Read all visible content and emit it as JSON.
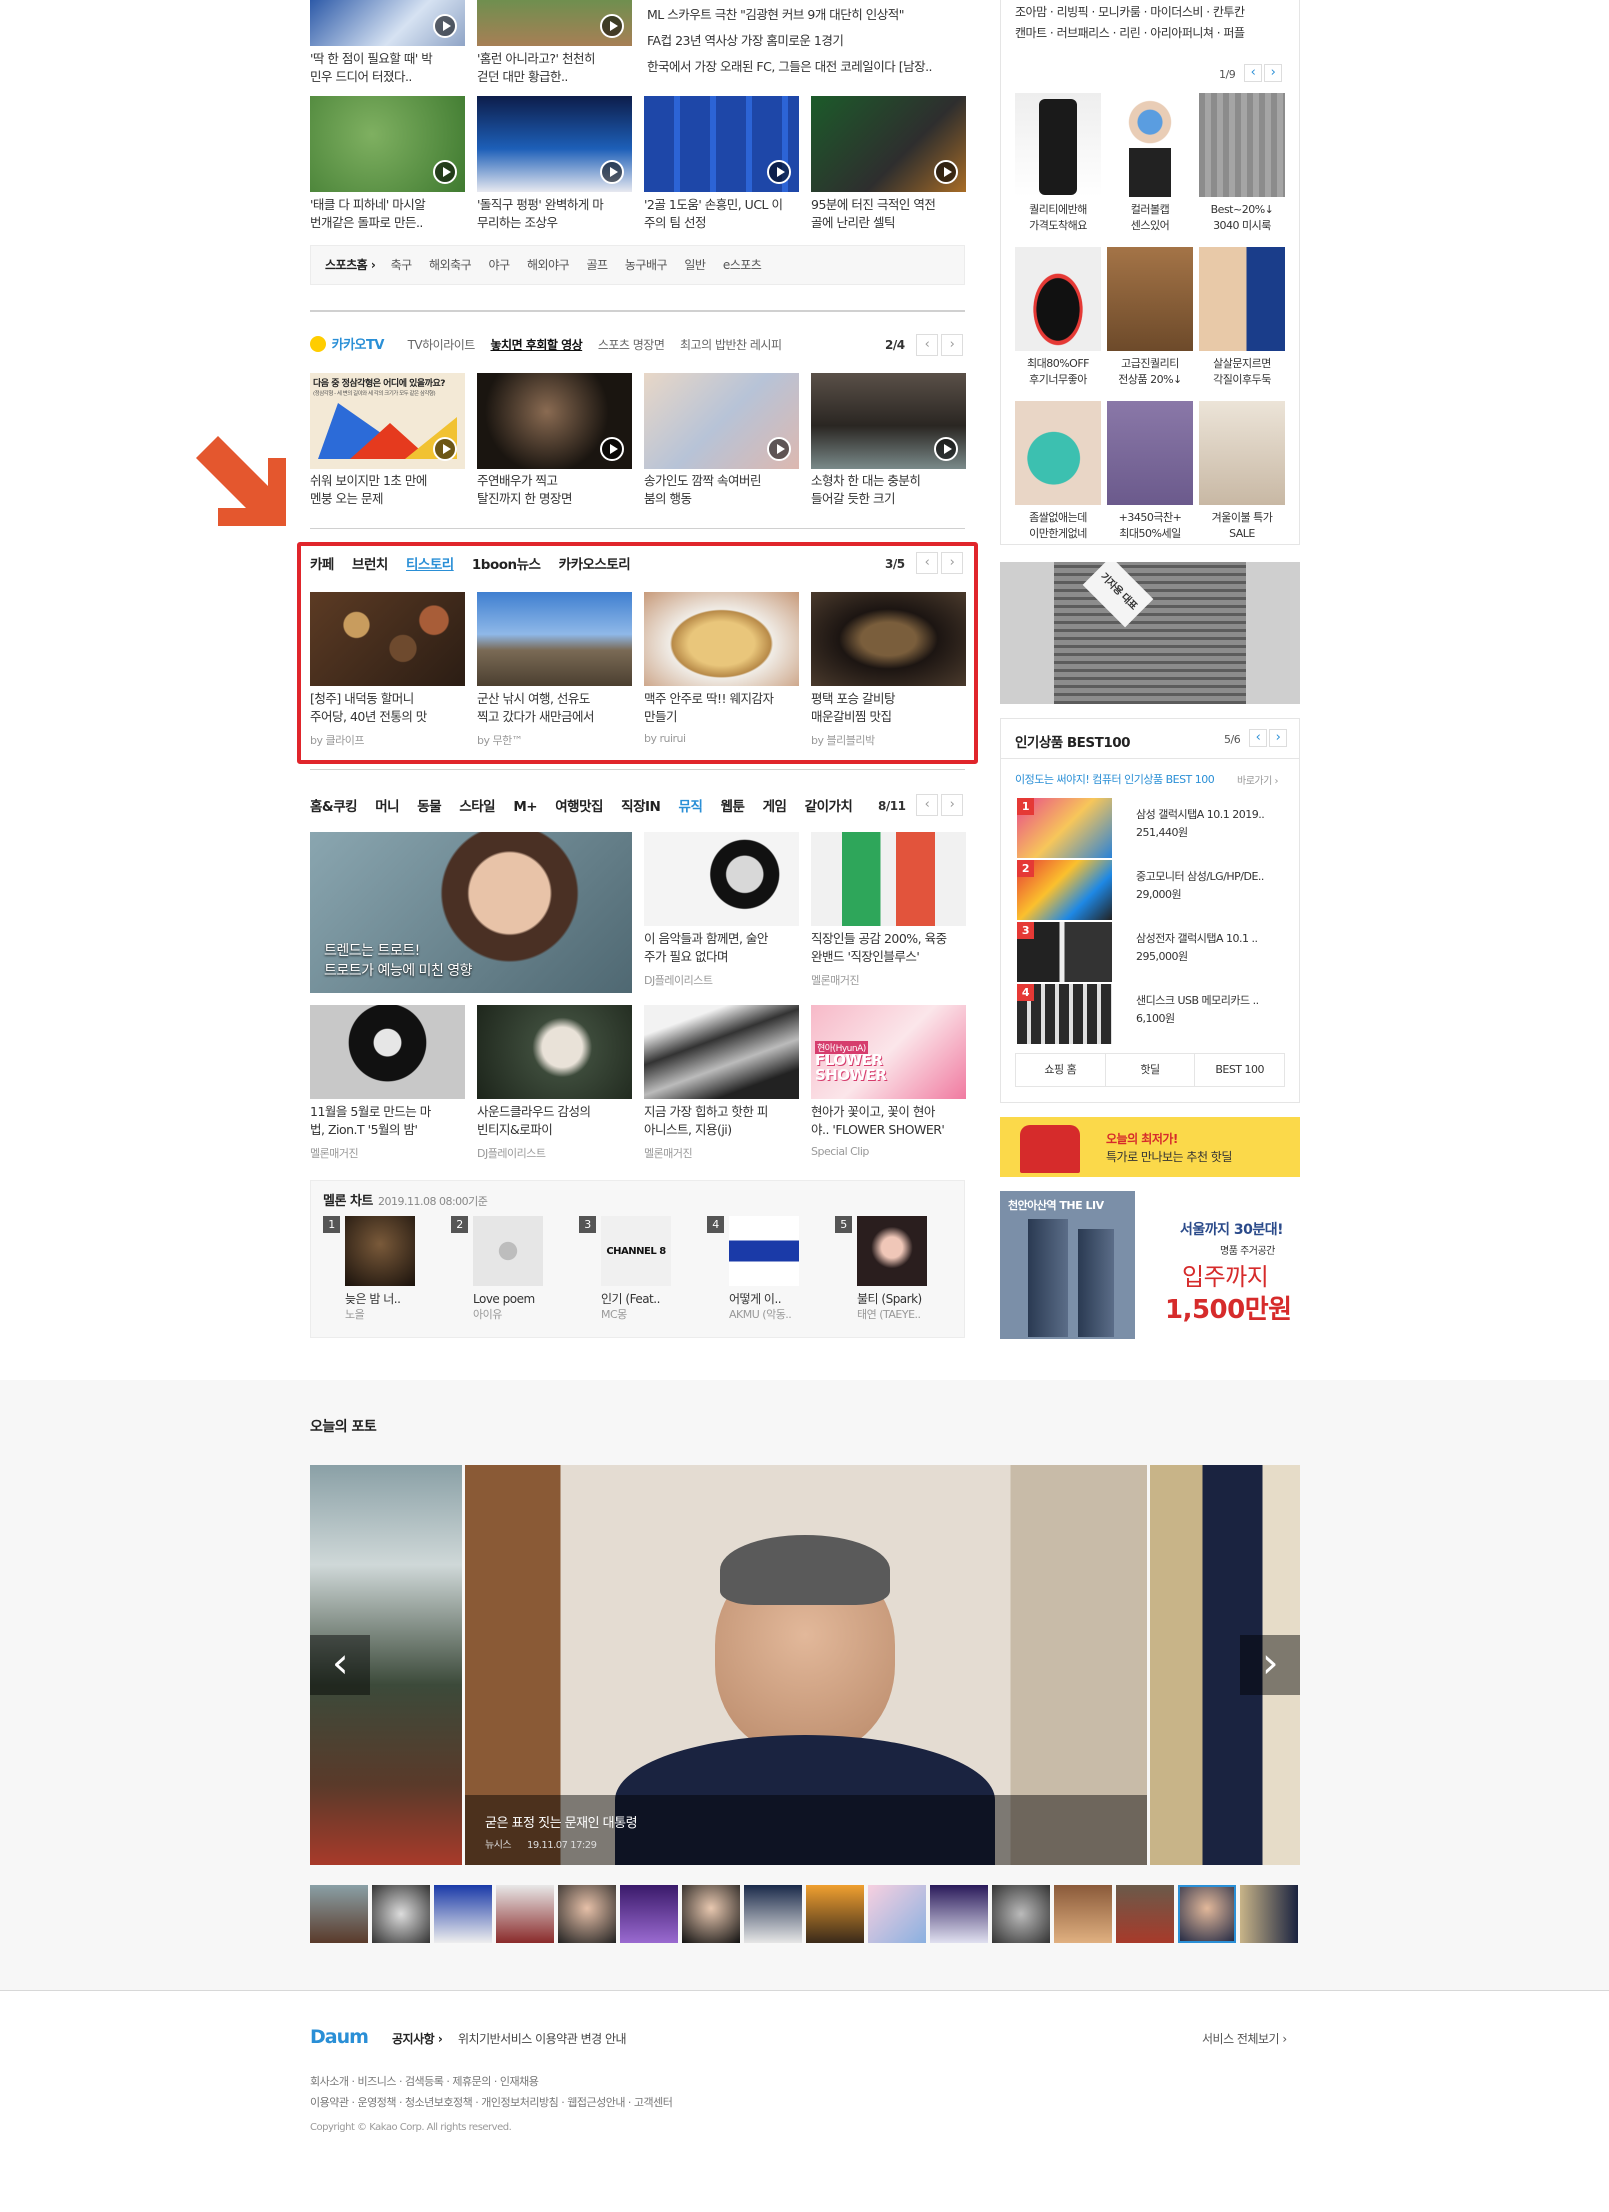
{
  "sports": {
    "top_captions": [
      "'딱 한 점이 필요할 때' 박\n민우 드디어 터졌다..",
      "'홈런 아니라고?' 천천히\n걷던 대만 황급한.."
    ],
    "headlines": [
      "ML 스카우트 극찬 \"김광현 커브 9개 대단히 인상적\"",
      "FA컵 23년 역사상 가장 홈미로운 1경기",
      "한국에서 가장 오래된 FC, 그들은 대전 코레일이다 [남장.."
    ],
    "row2_captions": [
      "'태클 다 피하네' 마시알\n번개같은 돌파로 만든..",
      "'돌직구 펑펑' 완벽하게 마\n무리하는 조상우",
      "'2골 1도움' 손흥민, UCL 이\n주의 팀 선정",
      "95분에 터진 극적인 역전\n골에 난리란 셀틱"
    ],
    "nav_home": "스포츠홈 ›",
    "nav_items": [
      "축구",
      "해외축구",
      "야구",
      "해외야구",
      "골프",
      "농구배구",
      "일반",
      "e스포츠"
    ]
  },
  "kakaotv": {
    "brand": "카카오TV",
    "tabs": [
      "TV하이라이트",
      "놓치면 후회할 영상",
      "스포츠 명장면",
      "최고의 밥반찬 레시피"
    ],
    "page": "2/4",
    "thumb1_title": "다음 중 정삼각형은 어디에 있을까요?",
    "thumb1_sub": "(정삼각형 - 세 변의 길이와 세 각의 크기가 모두 같은 삼각형)",
    "captions": [
      "쉬워 보이지만 1초 만에\n멘붕 오는 문제",
      "주연배우가 찍고\n탈진까지 한 명장면",
      "송가인도 깜짝 속여버린\n붐의 행동",
      "소형차 한 대는 충분히\n들어갈 듯한 크기"
    ]
  },
  "blog": {
    "tabs": [
      "카페",
      "브런치",
      "티스토리",
      "1boon뉴스",
      "카카오스토리"
    ],
    "active_tab": "티스토리",
    "page": "3/5",
    "captions": [
      "[청주] 내덕동 할머니\n주어당, 40년 전통의 맛",
      "군산 낚시 여행, 선유도\n찍고 갔다가 새만금에서",
      "맥주 안주로 딱!! 웨지감자\n만들기",
      "평택 포승 갈비탕\n매운갈비찜 맛집"
    ],
    "authors": [
      "by 클라이프",
      "by 무한™",
      "by ruirui",
      "by 블리블리박"
    ]
  },
  "culture": {
    "tabs": [
      "홈&쿠킹",
      "머니",
      "동물",
      "스타일",
      "M+",
      "여행맛집",
      "직장IN",
      "뮤직",
      "웹툰",
      "게임",
      "같이가치"
    ],
    "active_tab": "뮤직",
    "page": "8/11",
    "big_caption": "트렌드는 트로트!\n트로트가 예능에 미친 영향",
    "captions": [
      "이 음악들과 함께면, 술안\n주가 필요 없다며",
      "직장인들 공감 200%, 육중\n완밴드 '직장인블루스'",
      "11월을 5월로 만드는 마\n법, Zion.T '5월의 밤'",
      "사운드클라우드 감성의\n빈티지&로파이",
      "지금 가장 힙하고 핫한 피\n아니스트, 지용(ji)",
      "현아가 꽃이고, 꽃이 현아\n야.. 'FLOWER SHOWER'"
    ],
    "sources": [
      "DJ플레이리스트",
      "멜론매거진",
      "멜론매거진",
      "DJ플레이리스트",
      "멜론매거진",
      "Special Clip"
    ],
    "flower_text": "FLOWER\nSHOWER",
    "flower_badge": "현아(HyunA)"
  },
  "melon": {
    "title": "멜론 차트",
    "date": "2019.11.08 08:00기준",
    "items": [
      {
        "rank": "1",
        "song": "늦은 밤 너..",
        "artist": "노을"
      },
      {
        "rank": "2",
        "song": "Love poem",
        "artist": "아이유"
      },
      {
        "rank": "3",
        "song": "인기 (Feat..",
        "artist": "MC몽"
      },
      {
        "rank": "4",
        "song": "어떻게 이..",
        "artist": "AKMU (악동.."
      },
      {
        "rank": "5",
        "song": "불티 (Spark)",
        "artist": "태연 (TAEYE.."
      }
    ],
    "album3_text": "CHANNEL 8"
  },
  "right": {
    "brands_line1": "조아맘 · 리빙픽 · 모니카룸 · 마이더스비 · 칸투칸",
    "brands_line2": "캔마트 · 러브패리스 · 리린 · 아리아퍼니쳐 · 퍼플",
    "shop_page": "1/9",
    "shop_items": [
      "퀄리티에반해\n가격도착해요",
      "컬러볼캡\n센스있어",
      "Best~20%↓\n3040 미시룩",
      "최대80%OFF\n후기너무좋아",
      "고급진퀄리티\n전상품 20%↓",
      "살살문지르면\n각질이후두둑",
      "좀쌀없애는데\n이만한게없네",
      "+3450극찬+\n최대50%세일",
      "겨울이불 특가\nSALE"
    ],
    "bag_text": "기자용 대표",
    "best_title": "인기상품 BEST100",
    "best_page": "5/6",
    "best_sub": "이정도는 써야지! 컴퓨터 인기상품 BEST 100",
    "best_sub_link": "바로가기 ›",
    "best_items": [
      {
        "rank": "1",
        "name": "삼성 갤럭시탭A 10.1 2019..",
        "price": "251,440원"
      },
      {
        "rank": "2",
        "name": "중고모니터 삼성/LG/HP/DE..",
        "price": "29,000원"
      },
      {
        "rank": "3",
        "name": "삼성전자 갤럭시탭A 10.1 ..",
        "price": "295,000원"
      },
      {
        "rank": "4",
        "name": "샌디스크 USB 메모리카드 ..",
        "price": "6,100원"
      }
    ],
    "best_buttons": [
      "쇼핑 홈",
      "핫딜",
      "BEST 100"
    ],
    "ad1_line1": "오늘의 최저가!",
    "ad1_line2": "특가로 만나보는 추천 핫딜",
    "ad2_brand": "천안아산역 THE LIV",
    "ad2_line1": "서울까지 30분대!",
    "ad2_line2": "명품 주거공간",
    "ad2_line3": "입주까지",
    "ad2_line4": "1,500만원"
  },
  "photo": {
    "title": "오늘의 포토",
    "caption": "굳은 표정 짓는 문재인 대통령",
    "source": "뉴시스",
    "time": "19.11.07 17:29",
    "prev": "‹",
    "next": "›"
  },
  "footer": {
    "logo": "Daum",
    "notice_label": "공지사항 ›",
    "notice_text": "위치기반서비스 이용약관 변경 안내",
    "all_services": "서비스 전체보기 ›",
    "links1": "회사소개 · 비즈니스 · 검색등록 · 제휴문의 · 인재채용",
    "links2": "이용약관 · 운영정책 · 청소년보호정책 · 개인정보처리방침 · 웹접근성안내 · 고객센터",
    "copyright": "Copyright © Kakao Corp. All rights reserved."
  },
  "colors": {
    "highlight_box": "#e0252b",
    "arrow": "#e4572e",
    "active_blue": "#2a8fd6",
    "kakao_yellow": "#ffcd00"
  }
}
